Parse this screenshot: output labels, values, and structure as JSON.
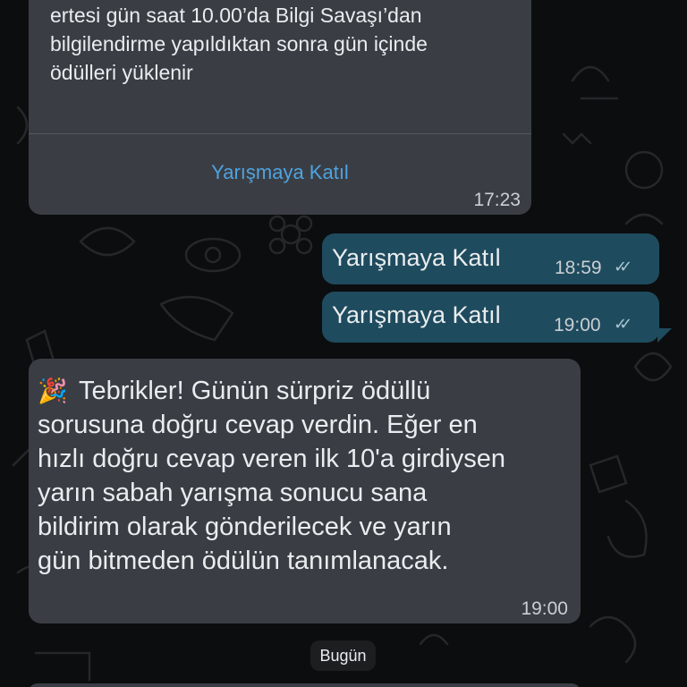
{
  "messages": {
    "first": {
      "text_line1": "ertesi gün saat 10.00’da Bilgi Savaşı’dan",
      "text_line2": "bilgilendirme yapıldıktan sonra gün içinde",
      "text_line3": "ödülleri yüklenir",
      "button_label": "Yarışmaya Katıl",
      "time": "17:23"
    },
    "out1": {
      "text": "Yarışmaya Katıl",
      "time": "18:59",
      "ticks": "✓✓"
    },
    "out2": {
      "text": "Yarışmaya Katıl",
      "time": "19:00",
      "ticks": "✓✓"
    },
    "congrats": {
      "emoji": "🎉",
      "lines": [
        "Tebrikler! Günün sürpriz ödüllü",
        "sorusuna doğru cevap verdin. Eğer en",
        "hızlı doğru cevap veren ilk 10'a girdiysen",
        "yarın sabah yarışma sonucu sana",
        "bildirim olarak gönderilecek ve yarın",
        "gün bitmeden ödülün tanımlanacak."
      ],
      "time": "19:00"
    }
  },
  "date_chip": "Bugün",
  "colors": {
    "incoming_bubble": "#3a3e44",
    "outgoing_bubble": "#1f4b5e",
    "link": "#4fa3e0",
    "background": "#0c0d0e"
  }
}
